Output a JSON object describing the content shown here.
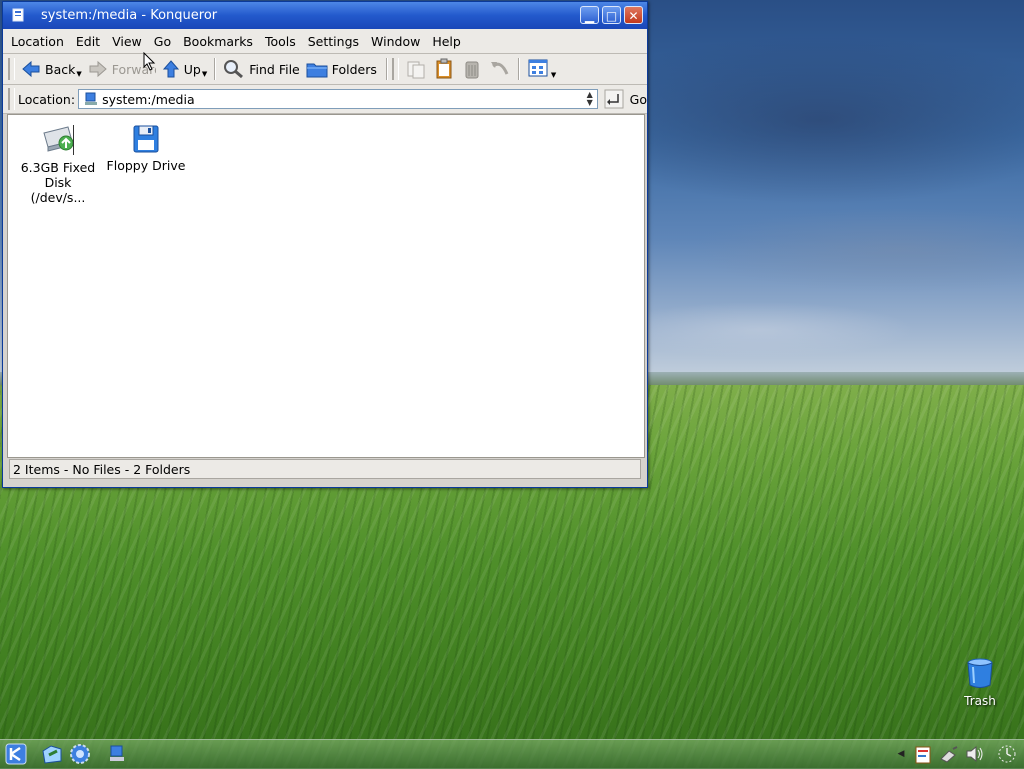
{
  "window": {
    "title": "system:/media - Konqueror",
    "controls": {
      "minimize": "▁",
      "maximize": "□",
      "close": "✕"
    }
  },
  "menubar": {
    "items": [
      "Location",
      "Edit",
      "View",
      "Go",
      "Bookmarks",
      "Tools",
      "Settings",
      "Window",
      "Help"
    ]
  },
  "toolbar": {
    "back": "Back",
    "forward": "Forward",
    "up": "Up",
    "find_file": "Find File",
    "folders": "Folders"
  },
  "location_bar": {
    "label": "Location:",
    "value": "system:/media",
    "go": "Go"
  },
  "files": [
    {
      "name_line1": "6.3GB Fixed",
      "name_line2": "Disk (/dev/s...",
      "icon": "hard-disk-icon"
    },
    {
      "name_line1": "Floppy Drive",
      "name_line2": "",
      "icon": "floppy-icon"
    }
  ],
  "status": "2 Items - No Files - 2 Folders",
  "desktop": {
    "trash_label": "Trash"
  },
  "colors": {
    "titlebar": "#2359cc",
    "window_bg": "#d6d3ce"
  }
}
